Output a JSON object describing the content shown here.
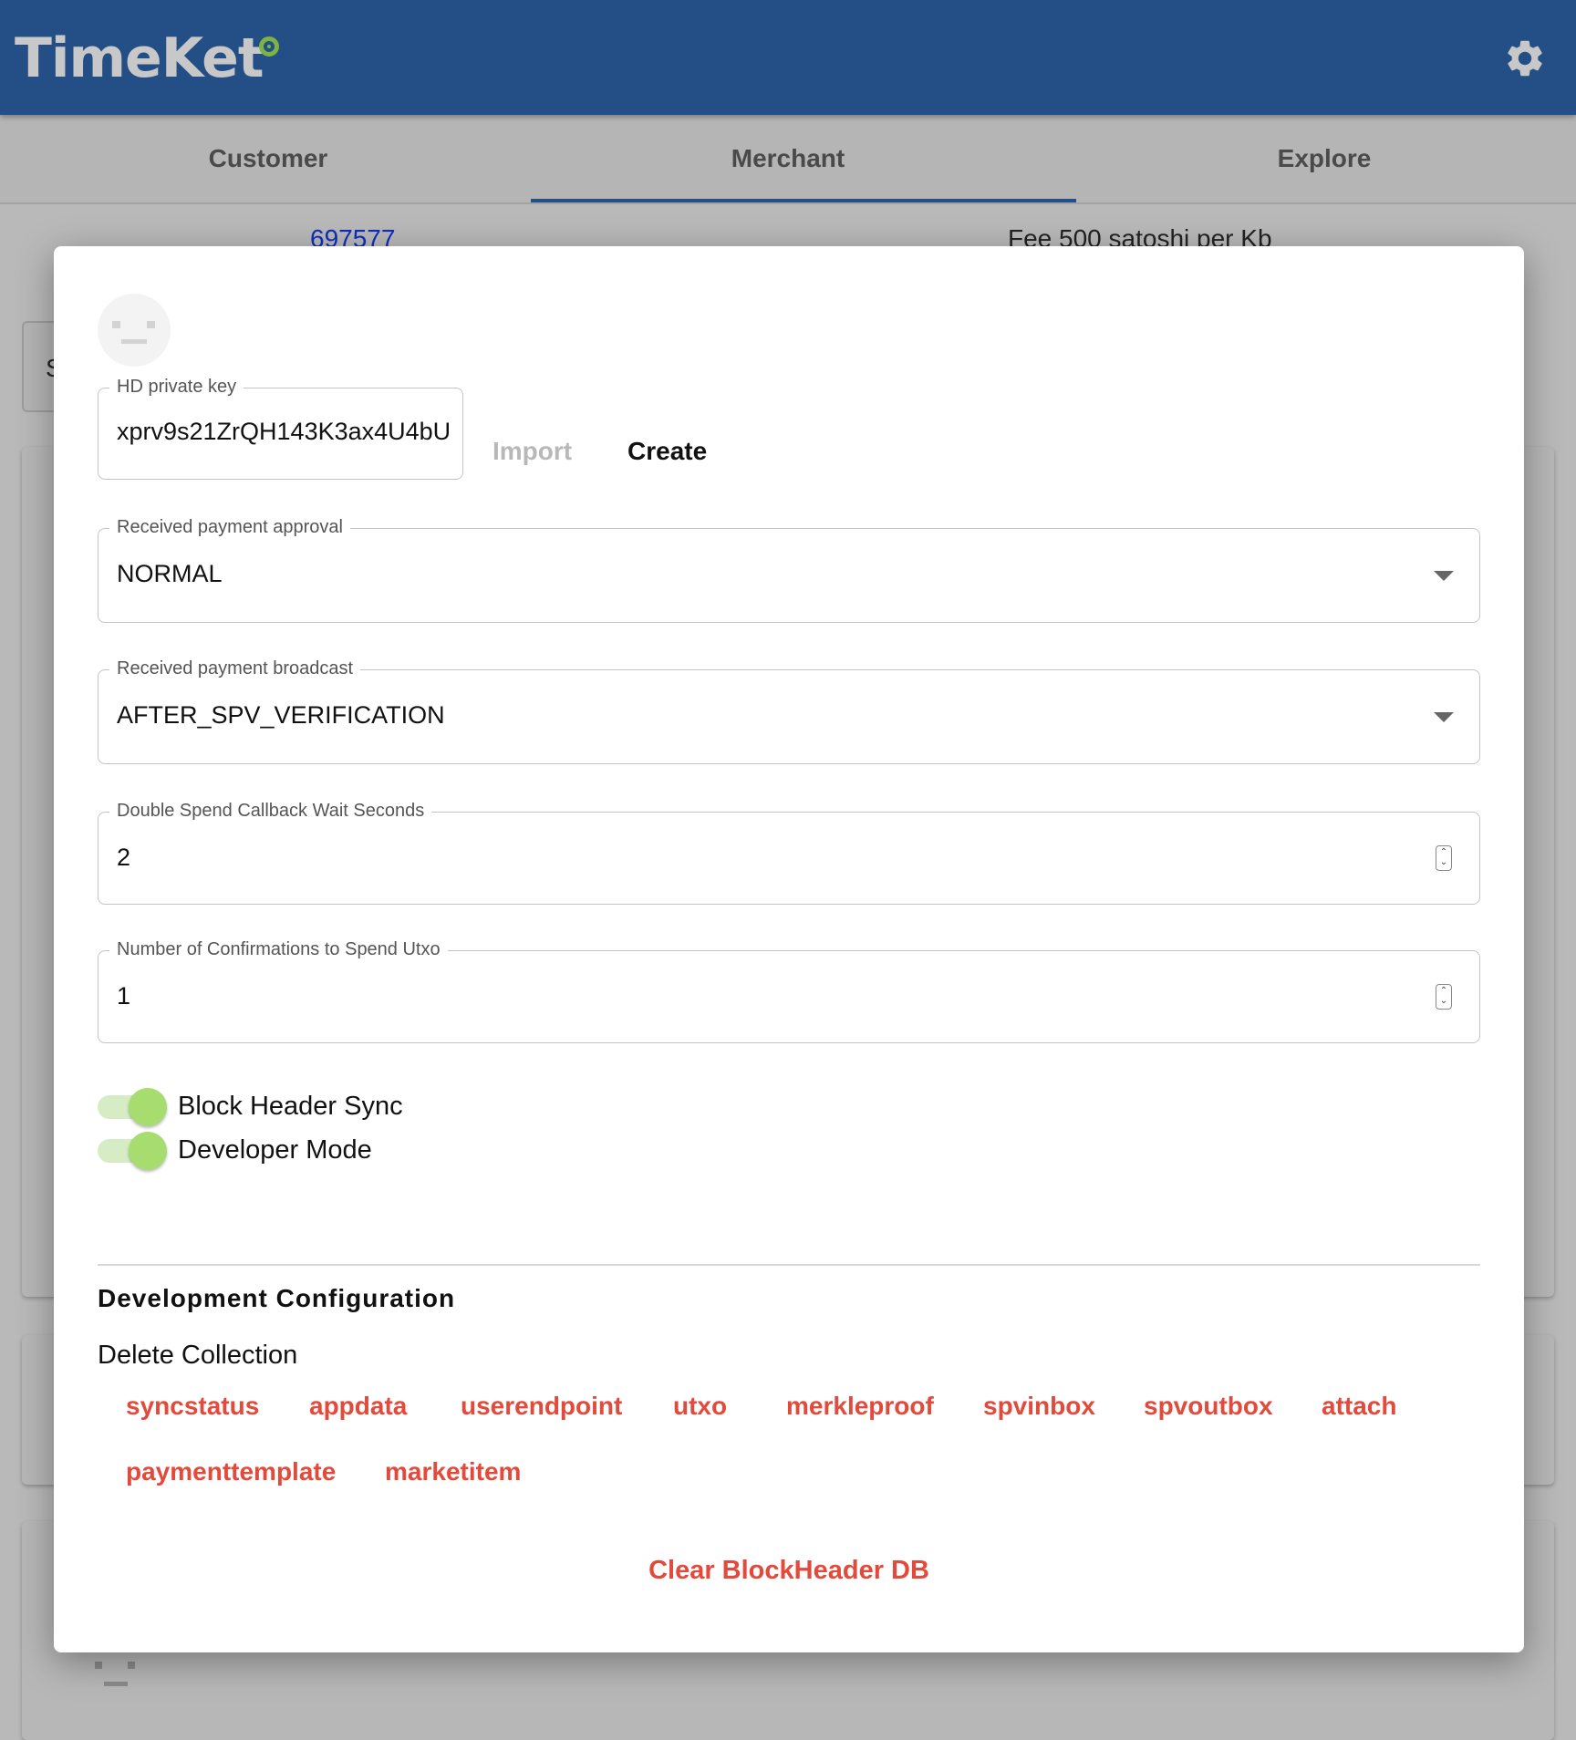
{
  "app": {
    "name": "TimeKet"
  },
  "header": {
    "settings_icon": "gear-icon"
  },
  "tabs": [
    {
      "label": "Customer"
    },
    {
      "label": "Merchant",
      "active": true
    },
    {
      "label": "Explore"
    }
  ],
  "background": {
    "block_height": "697577",
    "fee_text": "Fee 500 satoshi per Kb",
    "field_initial": "S"
  },
  "dialog": {
    "avatar_icon": "face-placeholder-icon",
    "hd_key": {
      "label": "HD private key",
      "value": "xprv9s21ZrQH143K3ax4U4bU",
      "import_label": "Import",
      "create_label": "Create"
    },
    "approval": {
      "label": "Received payment approval",
      "value": "NORMAL"
    },
    "broadcast": {
      "label": "Received payment broadcast",
      "value": "AFTER_SPV_VERIFICATION"
    },
    "double_spend": {
      "label": "Double Spend Callback Wait Seconds",
      "value": "2"
    },
    "confirmations": {
      "label": "Number of Confirmations to Spend Utxo",
      "value": "1"
    },
    "toggles": [
      {
        "label": "Block Header Sync",
        "on": true
      },
      {
        "label": "Developer Mode",
        "on": true
      }
    ],
    "dev_config": {
      "title": "Development Configuration",
      "delete_label": "Delete Collection",
      "collections": [
        "syncstatus",
        "appdata",
        "userendpoint",
        "utxo",
        "merkleproof",
        "spvinbox",
        "spvoutbox",
        "attach",
        "paymenttemplate",
        "marketitem"
      ],
      "clear_label": "Clear BlockHeader DB"
    }
  },
  "colors": {
    "appbar": "#234f86",
    "accent_red": "#e24a3b",
    "toggle_green": "#a6dd6e"
  }
}
